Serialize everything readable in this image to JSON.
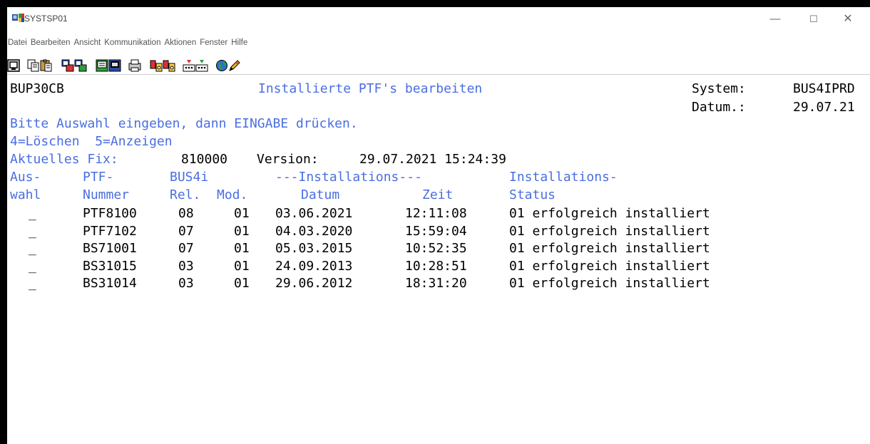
{
  "window": {
    "title": "SYSTSP01",
    "min_symbol": "—",
    "max_symbol": "☐",
    "close_symbol": "✕"
  },
  "menu": [
    "Datei",
    "Bearbeiten",
    "Ansicht",
    "Kommunikation",
    "Aktionen",
    "Fenster",
    "Hilfe"
  ],
  "toolbar_icons": [
    "display-screen-icon",
    "copy-icon",
    "paste-icon",
    "send-icon",
    "receive-icon",
    "macro-record-icon",
    "macro-play-icon",
    "print-screen-icon",
    "transfer-send-icon",
    "transfer-receive-icon",
    "keypad-icon",
    "keymap-icon",
    "globe-icon",
    "pencil-icon"
  ],
  "screen": {
    "program": "BUP30CB",
    "heading": "Installierte PTF's bearbeiten",
    "system_label": "System:",
    "system_value": "BUS4IPRD",
    "date_label": "Datum.:",
    "date_value": "29.07.21",
    "instruction": "Bitte Auswahl eingeben, dann EINGABE drücken.",
    "options": "4=Löschen  5=Anzeigen",
    "fix_label": "Aktuelles Fix:",
    "fix_value": "810000",
    "version_label": "Version:",
    "version_value": "29.07.2021 15:24:39",
    "header1": {
      "col1": "Aus-",
      "col2": "PTF-",
      "col3": "BUS4i",
      "col4": "---Installations---",
      "col5": "Installations-"
    },
    "header2": {
      "col1": "wahl",
      "col2": "Nummer",
      "col3a": "Rel.",
      "col3b": "Mod.",
      "col4a": "Datum",
      "col4b": "Zeit",
      "col5": "Status"
    },
    "rows": [
      {
        "sel": "_",
        "ptf": "PTF8100",
        "rel": "08",
        "mod": "01",
        "date": "03.06.2021",
        "time": "12:11:08",
        "status": "01 erfolgreich installiert"
      },
      {
        "sel": "_",
        "ptf": "PTF7102",
        "rel": "07",
        "mod": "01",
        "date": "04.03.2020",
        "time": "15:59:04",
        "status": "01 erfolgreich installiert"
      },
      {
        "sel": "_",
        "ptf": "BS71001",
        "rel": "07",
        "mod": "01",
        "date": "05.03.2015",
        "time": "10:52:35",
        "status": "01 erfolgreich installiert"
      },
      {
        "sel": "_",
        "ptf": "BS31015",
        "rel": "03",
        "mod": "01",
        "date": "24.09.2013",
        "time": "10:28:51",
        "status": "01 erfolgreich installiert"
      },
      {
        "sel": "_",
        "ptf": "BS31014",
        "rel": "03",
        "mod": "01",
        "date": "29.06.2012",
        "time": "18:31:20",
        "status": "01 erfolgreich installiert"
      }
    ]
  }
}
